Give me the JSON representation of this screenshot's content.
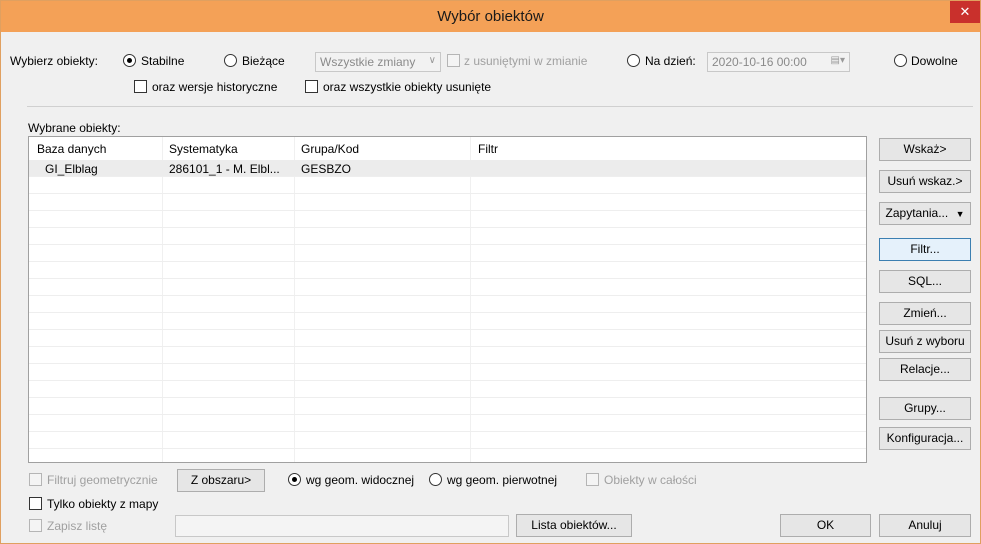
{
  "window": {
    "title": "Wybór obiektów",
    "close": "✕"
  },
  "select": {
    "label": "Wybierz obiekty:",
    "stable": "Stabilne",
    "current": "Bieżące",
    "changes_combo": "Wszystkie zmiany",
    "with_removed": "z usuniętymi w zmianie",
    "on_date": "Na dzień:",
    "date_value": "2020-10-16 00:00",
    "any": "Dowolne",
    "historical": "oraz wersje historyczne",
    "all_removed": "oraz wszystkie obiekty usunięte"
  },
  "selected": {
    "label": "Wybrane obiekty:",
    "columns": [
      "Baza danych",
      "Systematyka",
      "Grupa/Kod",
      "Filtr"
    ],
    "rows": [
      {
        "db": "GI_Elblag",
        "sys": "286101_1 - M. Elbl...",
        "group": "GESBZO",
        "filter": ""
      }
    ]
  },
  "side_buttons": {
    "point": "Wskaż>",
    "remove_point": "Usuń wskaz.>",
    "queries": "Zapytania...",
    "filter": "Filtr...",
    "sql": "SQL...",
    "change": "Zmień...",
    "remove_sel": "Usuń z wyboru",
    "relations": "Relacje...",
    "groups": "Grupy...",
    "config": "Konfiguracja..."
  },
  "bottom": {
    "geo_filter": "Filtruj geometrycznie",
    "from_area": "Z obszaru>",
    "visible_geom": "wg geom. widocznej",
    "original_geom": "wg geom. pierwotnej",
    "whole_objects": "Obiekty w całości",
    "map_only": "Tylko obiekty z mapy",
    "save_list": "Zapisz listę",
    "object_list": "Lista obiektów...",
    "ok": "OK",
    "cancel": "Anuluj"
  }
}
